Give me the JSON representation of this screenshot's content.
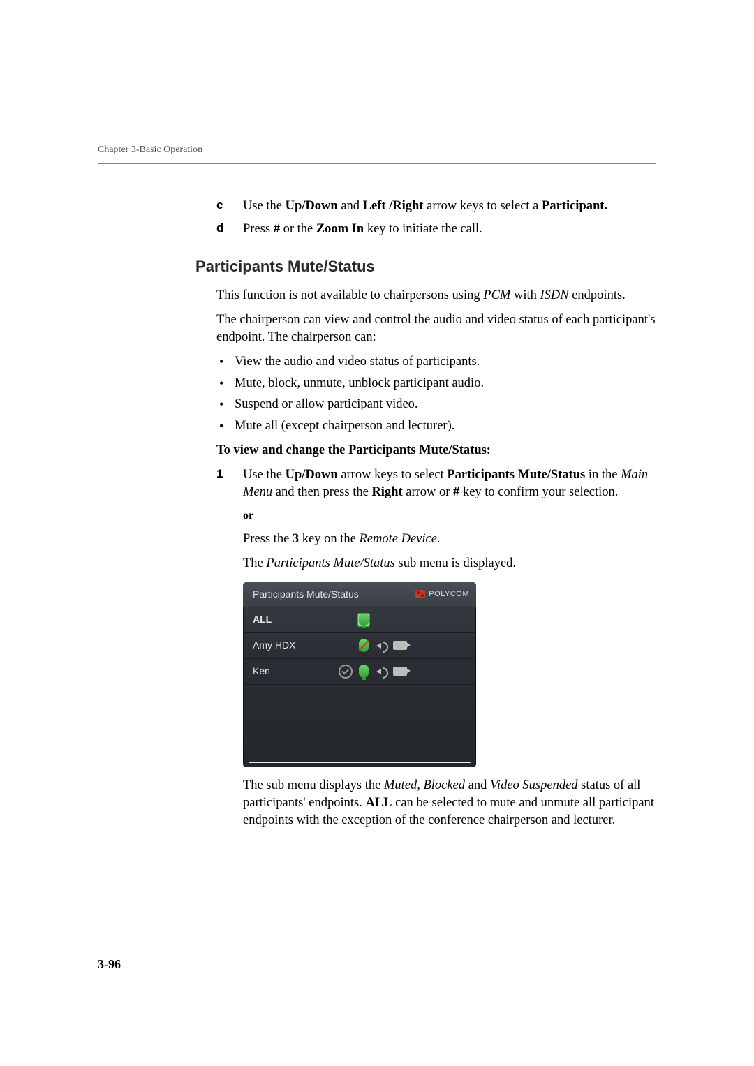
{
  "header": {
    "running": "Chapter 3-Basic Operation"
  },
  "steps_letter": {
    "c": {
      "marker": "c",
      "pre": "Use the ",
      "b1": "Up/Down",
      "mid1": " and ",
      "b2": "Left /Right",
      "mid2": " arrow keys to select a ",
      "b3": "Participant."
    },
    "d": {
      "marker": "d",
      "pre": "Press ",
      "b1": "#",
      "mid1": " or the ",
      "b2": "Zoom In",
      "post": " key to initiate the call."
    }
  },
  "section": {
    "heading": "Participants Mute/Status",
    "intro1_a": "This function is not available to chairpersons using ",
    "intro1_i1": "PCM",
    "intro1_b": " with ",
    "intro1_i2": "ISDN",
    "intro1_c": " endpoints.",
    "intro2": "The chairperson can view and control the audio and video status of each participant's endpoint. The chairperson can:",
    "bullets": [
      "View the audio and video status of participants.",
      "Mute, block, unmute, unblock participant audio.",
      "Suspend or allow participant video.",
      "Mute all (except chairperson and lecturer)."
    ],
    "procedure_title": "To view and change the Participants Mute/Status:",
    "step1": {
      "marker": "1",
      "a": "Use the ",
      "b1": "Up/Down",
      "b": " arrow keys to select ",
      "b2": "Participants Mute/Status",
      "c": " in the ",
      "i1": "Main Menu",
      "d": " and then press the ",
      "b3": "Right",
      "e": " arrow or ",
      "b4": "#",
      "f": " key to confirm your selection."
    },
    "or": "or",
    "press3_a": "Press the ",
    "press3_b": "3",
    "press3_c": " key on the ",
    "press3_i": "Remote Device",
    "press3_d": ".",
    "displayed_a": "The ",
    "displayed_i": "Participants Mute/Status",
    "displayed_b": " sub menu is displayed.",
    "after_panel_a": "The sub menu displays the ",
    "after_panel_i1": "Muted, Blocked",
    "after_panel_b": " and ",
    "after_panel_i2": "Video Suspended",
    "after_panel_c": " status of all participants' endpoints. ",
    "after_panel_bold": "ALL",
    "after_panel_d": " can be selected to mute and unmute all participant endpoints with the exception of the conference chairperson and lecturer."
  },
  "panel": {
    "title": "Participants Mute/Status",
    "brand": "POLYCOM",
    "rows": {
      "all": "ALL",
      "amy": "Amy HDX",
      "ken": "Ken"
    }
  },
  "page_number": "3-96"
}
